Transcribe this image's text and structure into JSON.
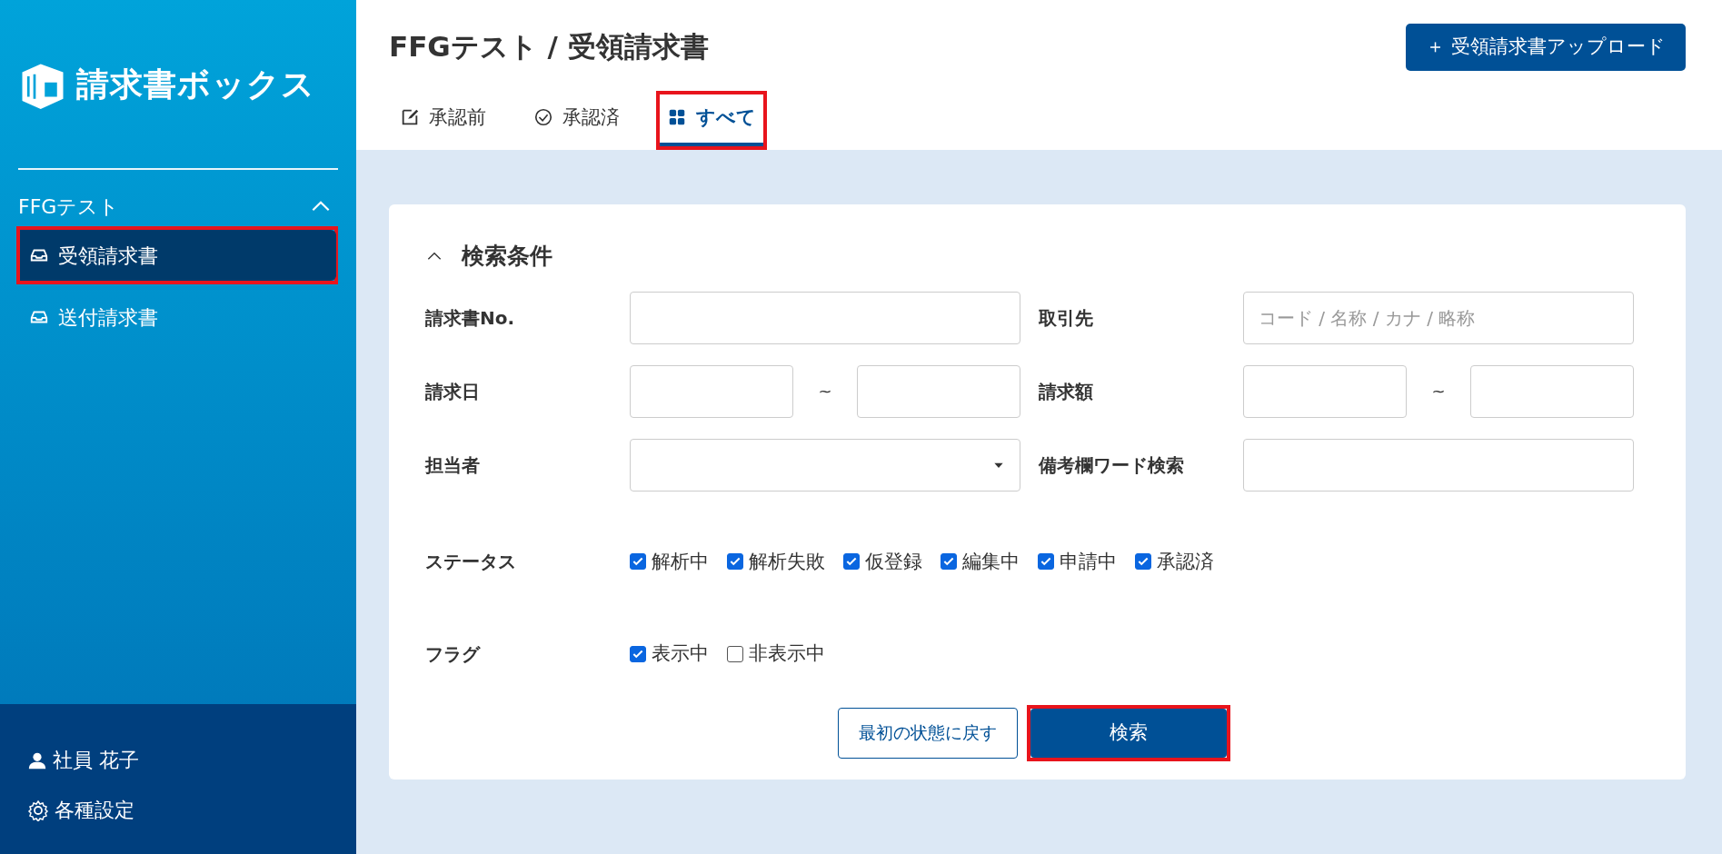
{
  "sidebar": {
    "logo_text": "請求書ボックス",
    "group": {
      "label": "FFGテスト",
      "expanded": true
    },
    "items": [
      {
        "label": "受領請求書",
        "selected": true,
        "highlighted": true
      },
      {
        "label": "送付請求書",
        "selected": false,
        "highlighted": false
      }
    ],
    "user": "社員 花子",
    "settings": "各種設定"
  },
  "header": {
    "title": "FFGテスト / 受領請求書",
    "upload_button": "＋ 受領請求書アップロード"
  },
  "tabs": [
    {
      "label": "承認前",
      "kind": "edit",
      "selected": false,
      "highlighted": false
    },
    {
      "label": "承認済",
      "kind": "check",
      "selected": false,
      "highlighted": false
    },
    {
      "label": "すべて",
      "kind": "grid",
      "selected": true,
      "highlighted": true
    }
  ],
  "search_panel": {
    "title": "検索条件",
    "expanded": true,
    "fields": [
      {
        "label": "請求書No.",
        "kind": "text"
      },
      {
        "label": "取引先",
        "kind": "text",
        "placeholder": "コード / 名称 / カナ / 略称"
      },
      {
        "label": "請求日",
        "kind": "range",
        "separator": "~"
      },
      {
        "label": "請求額",
        "kind": "range",
        "separator": "~"
      },
      {
        "label": "担当者",
        "kind": "select"
      },
      {
        "label": "備考欄ワード検索",
        "kind": "text"
      }
    ],
    "checkgroups": [
      {
        "label": "ステータス",
        "options": [
          {
            "label": "解析中",
            "checked": true
          },
          {
            "label": "解析失敗",
            "checked": true
          },
          {
            "label": "仮登録",
            "checked": true
          },
          {
            "label": "編集中",
            "checked": true
          },
          {
            "label": "申請中",
            "checked": true
          },
          {
            "label": "承認済",
            "checked": true
          }
        ]
      },
      {
        "label": "フラグ",
        "options": [
          {
            "label": "表示中",
            "checked": true
          },
          {
            "label": "非表示中",
            "checked": false
          }
        ]
      }
    ],
    "reset_button": "最初の状態に戻す",
    "search_button": {
      "label": "検索",
      "highlighted": true
    }
  }
}
